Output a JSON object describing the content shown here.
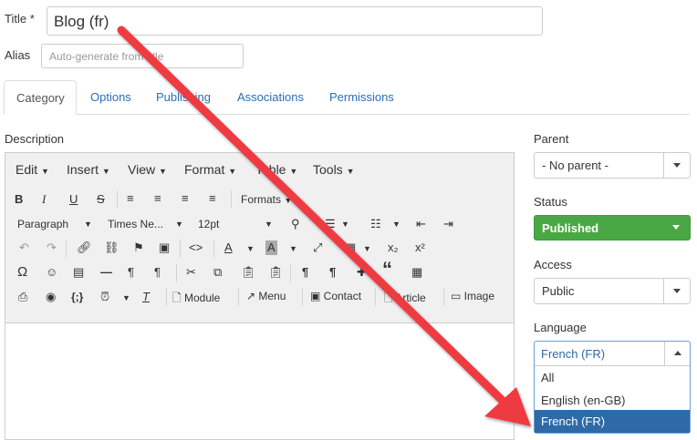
{
  "form": {
    "title_label": "Title *",
    "title_value": "Blog (fr)",
    "alias_label": "Alias",
    "alias_placeholder": "Auto-generate from title"
  },
  "tabs": [
    {
      "label": "Category"
    },
    {
      "label": "Options"
    },
    {
      "label": "Publishing"
    },
    {
      "label": "Associations"
    },
    {
      "label": "Permissions"
    }
  ],
  "description_label": "Description",
  "editor": {
    "menus": [
      "Edit",
      "Insert",
      "View",
      "Format",
      "Table",
      "Tools"
    ],
    "formats_label": "Formats",
    "paragraph_label": "Paragraph",
    "font_label": "Times Ne...",
    "size_label": "12pt",
    "module_label": "Module",
    "menu_label": "Menu",
    "contact_label": "Contact",
    "article_label": "Article",
    "image_label": "Image"
  },
  "sidebar": {
    "parent_label": "Parent",
    "parent_value": "- No parent -",
    "status_label": "Status",
    "status_value": "Published",
    "access_label": "Access",
    "access_value": "Public",
    "language_label": "Language",
    "language_value": "French (FR)",
    "language_options": [
      "All",
      "English (en-GB)",
      "French (FR)"
    ]
  },
  "colors": {
    "status_green": "#4aa844",
    "selected_option": "#2d6aa7",
    "arrow_red": "#ee3a43",
    "tab_link": "#2a6fb4"
  }
}
